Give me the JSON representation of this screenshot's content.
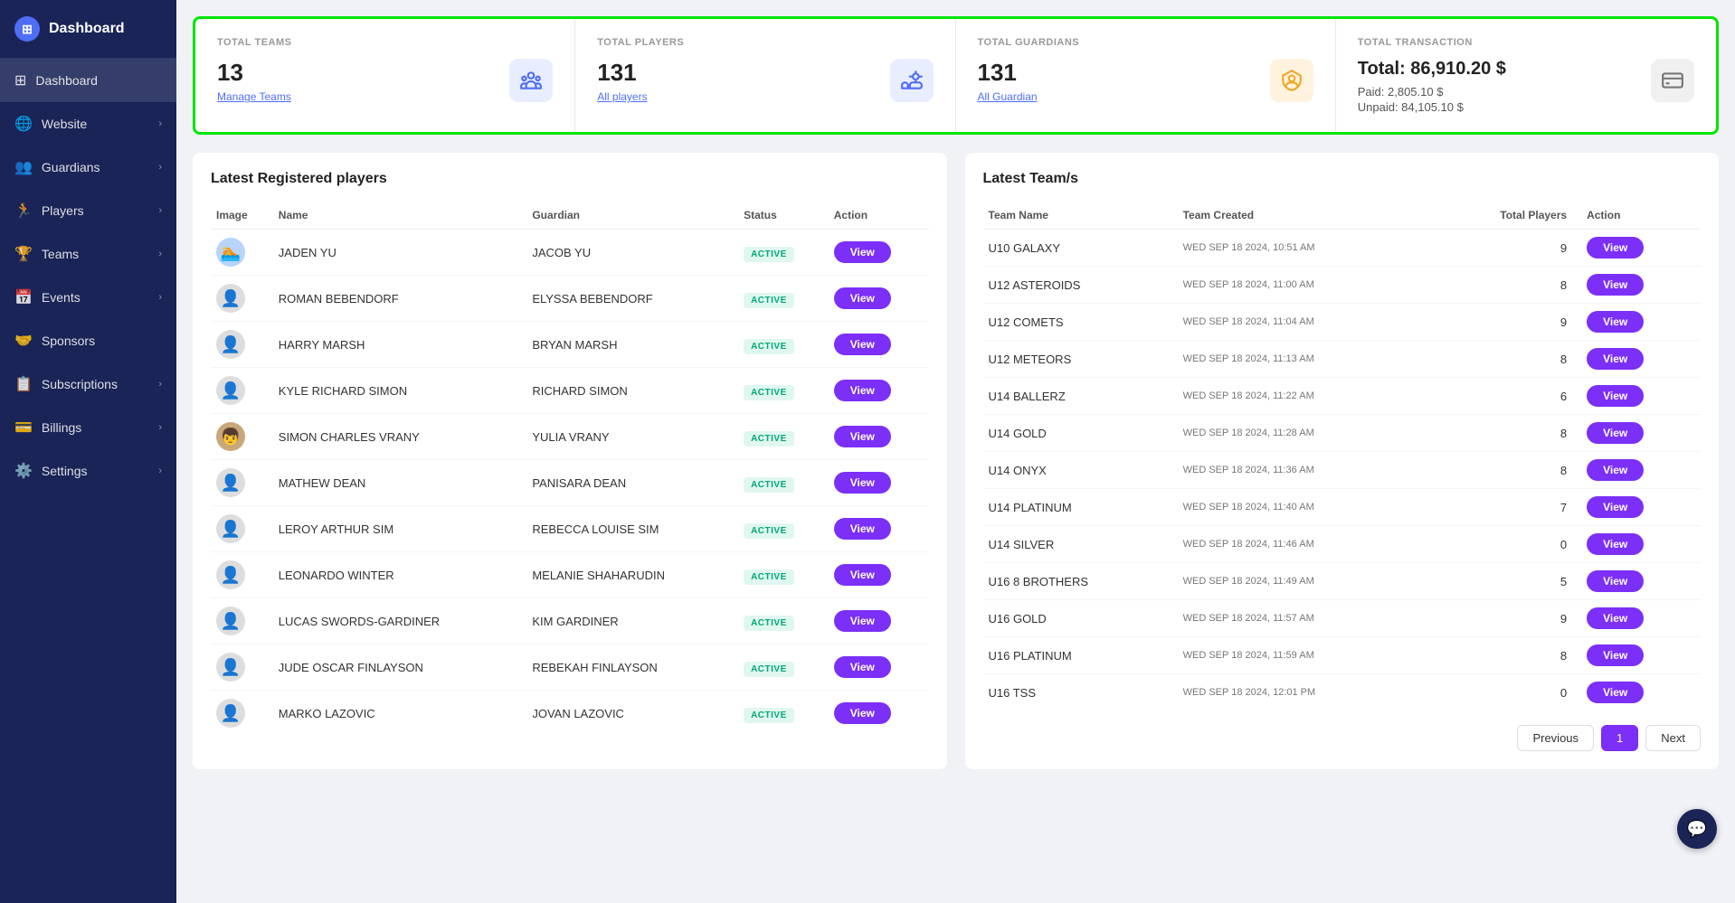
{
  "sidebar": {
    "logo": "Dashboard",
    "items": [
      {
        "id": "dashboard",
        "label": "Dashboard",
        "icon": "⊞",
        "hasChevron": false,
        "active": true
      },
      {
        "id": "website",
        "label": "Website",
        "icon": "🌐",
        "hasChevron": true,
        "active": false
      },
      {
        "id": "guardians",
        "label": "Guardians",
        "icon": "👥",
        "hasChevron": true,
        "active": false
      },
      {
        "id": "players",
        "label": "Players",
        "icon": "🏃",
        "hasChevron": true,
        "active": false
      },
      {
        "id": "teams",
        "label": "Teams",
        "icon": "🏆",
        "hasChevron": true,
        "active": false
      },
      {
        "id": "events",
        "label": "Events",
        "icon": "📅",
        "hasChevron": true,
        "active": false
      },
      {
        "id": "sponsors",
        "label": "Sponsors",
        "icon": "🤝",
        "hasChevron": false,
        "active": false
      },
      {
        "id": "subscriptions",
        "label": "Subscriptions",
        "icon": "📋",
        "hasChevron": true,
        "active": false
      },
      {
        "id": "billings",
        "label": "Billings",
        "icon": "💳",
        "hasChevron": true,
        "active": false
      },
      {
        "id": "settings",
        "label": "Settings",
        "icon": "⚙️",
        "hasChevron": true,
        "active": false
      }
    ]
  },
  "stats": {
    "total_teams": {
      "label": "TOTAL TEAMS",
      "value": "13",
      "link": "Manage Teams"
    },
    "total_players": {
      "label": "TOTAL PLAYERS",
      "value": "131",
      "link": "All players"
    },
    "total_guardians": {
      "label": "TOTAL GUARDIANS",
      "value": "131",
      "link": "All Guardian"
    },
    "total_transaction": {
      "label": "TOTAL TRANSACTION",
      "total": "Total:  86,910.20 $",
      "paid": "Paid: 2,805.10 $",
      "unpaid": "Unpaid:  84,105.10 $"
    }
  },
  "players_section": {
    "title": "Latest Registered players",
    "columns": [
      "Image",
      "Name",
      "Guardian",
      "Status",
      "Action"
    ],
    "rows": [
      {
        "name": "JADEN YU",
        "guardian": "JACOB YU",
        "status": "ACTIVE",
        "avatar_type": "photo"
      },
      {
        "name": "ROMAN BEBENDORF",
        "guardian": "ELYSSA BEBENDORF",
        "status": "ACTIVE",
        "avatar_type": "red"
      },
      {
        "name": "HARRY MARSH",
        "guardian": "BRYAN MARSH",
        "status": "ACTIVE",
        "avatar_type": "red"
      },
      {
        "name": "KYLE RICHARD SIMON",
        "guardian": "RICHARD SIMON",
        "status": "ACTIVE",
        "avatar_type": "red"
      },
      {
        "name": "SIMON CHARLES VRANY",
        "guardian": "YULIA VRANY",
        "status": "ACTIVE",
        "avatar_type": "photo2"
      },
      {
        "name": "MATHEW DEAN",
        "guardian": "PANISARA DEAN",
        "status": "ACTIVE",
        "avatar_type": "red"
      },
      {
        "name": "LEROY ARTHUR SIM",
        "guardian": "REBECCA LOUISE SIM",
        "status": "ACTIVE",
        "avatar_type": "red"
      },
      {
        "name": "LEONARDO WINTER",
        "guardian": "MELANIE SHAHARUDIN",
        "status": "ACTIVE",
        "avatar_type": "red"
      },
      {
        "name": "LUCAS SWORDS-GARDINER",
        "guardian": "KIM GARDINER",
        "status": "ACTIVE",
        "avatar_type": "red"
      },
      {
        "name": "JUDE OSCAR FINLAYSON",
        "guardian": "REBEKAH FINLAYSON",
        "status": "ACTIVE",
        "avatar_type": "red"
      },
      {
        "name": "MARKO LAZOVIC",
        "guardian": "JOVAN LAZOVIC",
        "status": "ACTIVE",
        "avatar_type": "red"
      }
    ],
    "view_btn": "View"
  },
  "teams_section": {
    "title": "Latest Team/s",
    "columns": [
      "Team Name",
      "Team Created",
      "Total Players",
      "Action"
    ],
    "rows": [
      {
        "name": "U10 GALAXY",
        "created": "WED SEP 18 2024, 10:51 AM",
        "total": "9"
      },
      {
        "name": "U12 ASTEROIDS",
        "created": "WED SEP 18 2024, 11:00 AM",
        "total": "8"
      },
      {
        "name": "U12 COMETS",
        "created": "WED SEP 18 2024, 11:04 AM",
        "total": "9"
      },
      {
        "name": "U12 METEORS",
        "created": "WED SEP 18 2024, 11:13 AM",
        "total": "8"
      },
      {
        "name": "U14 BALLERZ",
        "created": "WED SEP 18 2024, 11:22 AM",
        "total": "6"
      },
      {
        "name": "U14 GOLD",
        "created": "WED SEP 18 2024, 11:28 AM",
        "total": "8"
      },
      {
        "name": "U14 ONYX",
        "created": "WED SEP 18 2024, 11:36 AM",
        "total": "8"
      },
      {
        "name": "U14 PLATINUM",
        "created": "WED SEP 18 2024, 11:40 AM",
        "total": "7"
      },
      {
        "name": "U14 SILVER",
        "created": "WED SEP 18 2024, 11:46 AM",
        "total": "0"
      },
      {
        "name": "U16 8 BROTHERS",
        "created": "WED SEP 18 2024, 11:49 AM",
        "total": "5"
      },
      {
        "name": "U16 GOLD",
        "created": "WED SEP 18 2024, 11:57 AM",
        "total": "9"
      },
      {
        "name": "U16 PLATINUM",
        "created": "WED SEP 18 2024, 11:59 AM",
        "total": "8"
      },
      {
        "name": "U16 TSS",
        "created": "WED SEP 18 2024, 12:01 PM",
        "total": "0"
      }
    ],
    "view_btn": "View",
    "pagination": {
      "previous": "Previous",
      "next": "Next",
      "current_page": "1"
    }
  }
}
